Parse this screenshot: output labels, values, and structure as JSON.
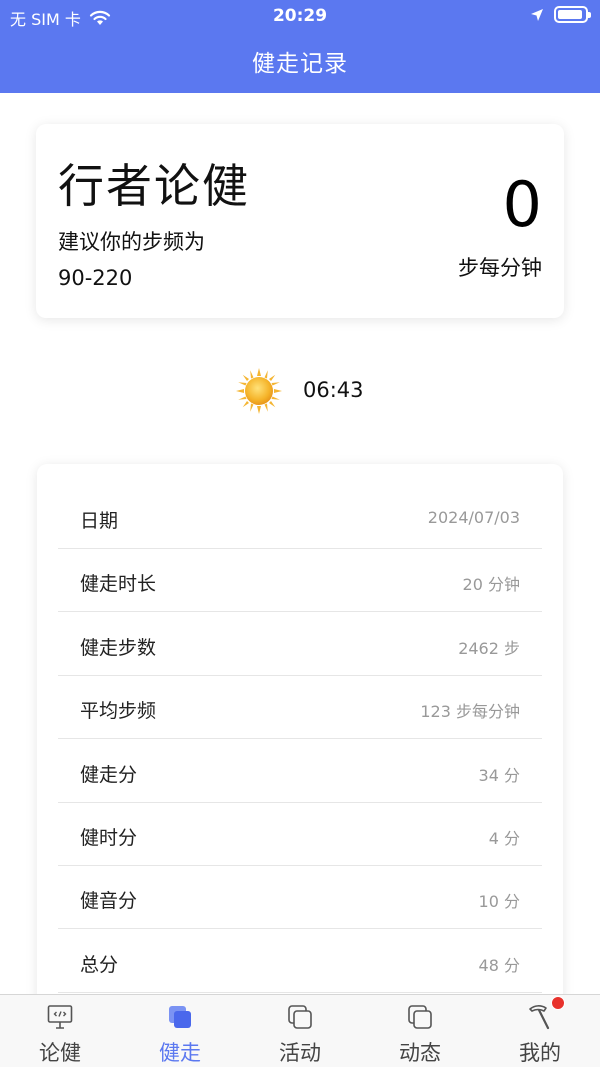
{
  "status_bar": {
    "carrier": "无 SIM 卡",
    "time": "20:29"
  },
  "header": {
    "title": "健走记录"
  },
  "hero": {
    "title": "行者论健",
    "suggestion": "建议你的步频为",
    "range": "90-220",
    "cadence_value": "0",
    "cadence_unit": "步每分钟"
  },
  "sun": {
    "icon": "sun-icon",
    "time": "06:43"
  },
  "details": [
    {
      "label": "日期",
      "value": "2024/07/03"
    },
    {
      "label": "健走时长",
      "value": "20 分钟"
    },
    {
      "label": "健走步数",
      "value": "2462 步"
    },
    {
      "label": "平均步频",
      "value": "123 步每分钟"
    },
    {
      "label": "健走分",
      "value": "34 分"
    },
    {
      "label": "健时分",
      "value": "4 分"
    },
    {
      "label": "健音分",
      "value": "10 分"
    },
    {
      "label": "总分",
      "value": "48 分"
    }
  ],
  "tabs": [
    {
      "label": "论健",
      "icon": "monitor-code-icon"
    },
    {
      "label": "健走",
      "icon": "stacked-squares-icon",
      "active": true
    },
    {
      "label": "活动",
      "icon": "stacked-squares-icon"
    },
    {
      "label": "动态",
      "icon": "stacked-squares-icon"
    },
    {
      "label": "我的",
      "icon": "hammer-icon"
    }
  ],
  "colors": {
    "primary": "#5b78f0",
    "badge": "#e8322c",
    "muted_text": "#999999"
  }
}
